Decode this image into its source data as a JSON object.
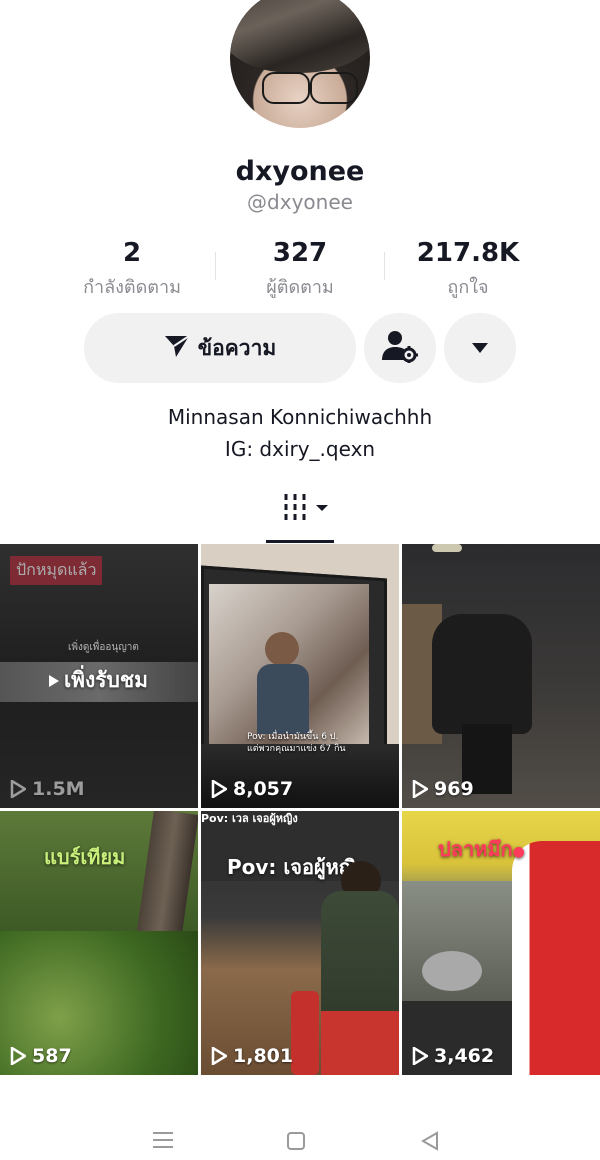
{
  "profile": {
    "display_name": "dxyonee",
    "username": "@dxyonee"
  },
  "stats": [
    {
      "value": "2",
      "label": "กำลังติดตาม"
    },
    {
      "value": "327",
      "label": "ผู้ติดตาม"
    },
    {
      "value": "217.8K",
      "label": "ถูกใจ"
    }
  ],
  "actions": {
    "message_label": "ข้อความ",
    "send_icon": "send-icon",
    "add_friend_icon": "person-settings-icon",
    "more_icon": "caret-down-icon"
  },
  "bio": {
    "line1": "Minnasan Konnichiwachhh",
    "line2": "IG: dxiry_.qexn"
  },
  "tabs": {
    "active_icon": "grid-icon"
  },
  "videos": [
    {
      "views": "1.5M",
      "overlay": "เพิ่งรับชม",
      "banner": "ปักหมุดแล้ว",
      "tiny_caption": "เพิ่งดูเพื่ออนุญาต"
    },
    {
      "views": "8,057",
      "caption_line1": "Pov: เมื่อนำมันขึ้น 6 ป.",
      "caption_line2": "แต่พวกคุณมาแข่ง 67 กิน"
    },
    {
      "views": "969"
    },
    {
      "views": "587",
      "overlay": "แบร์เทียม"
    },
    {
      "views": "1,801",
      "overlay": "Pov: เจอผู้หญิง",
      "tiny_caption": "Pov: เวล เจอผู้หญิง"
    },
    {
      "views": "3,462",
      "overlay": "ปลาหมึก"
    }
  ],
  "colors": {
    "text_primary": "#161823",
    "text_secondary": "#8a8b91",
    "button_bg": "#f1f1f2",
    "banner_red": "#fe2c55"
  }
}
